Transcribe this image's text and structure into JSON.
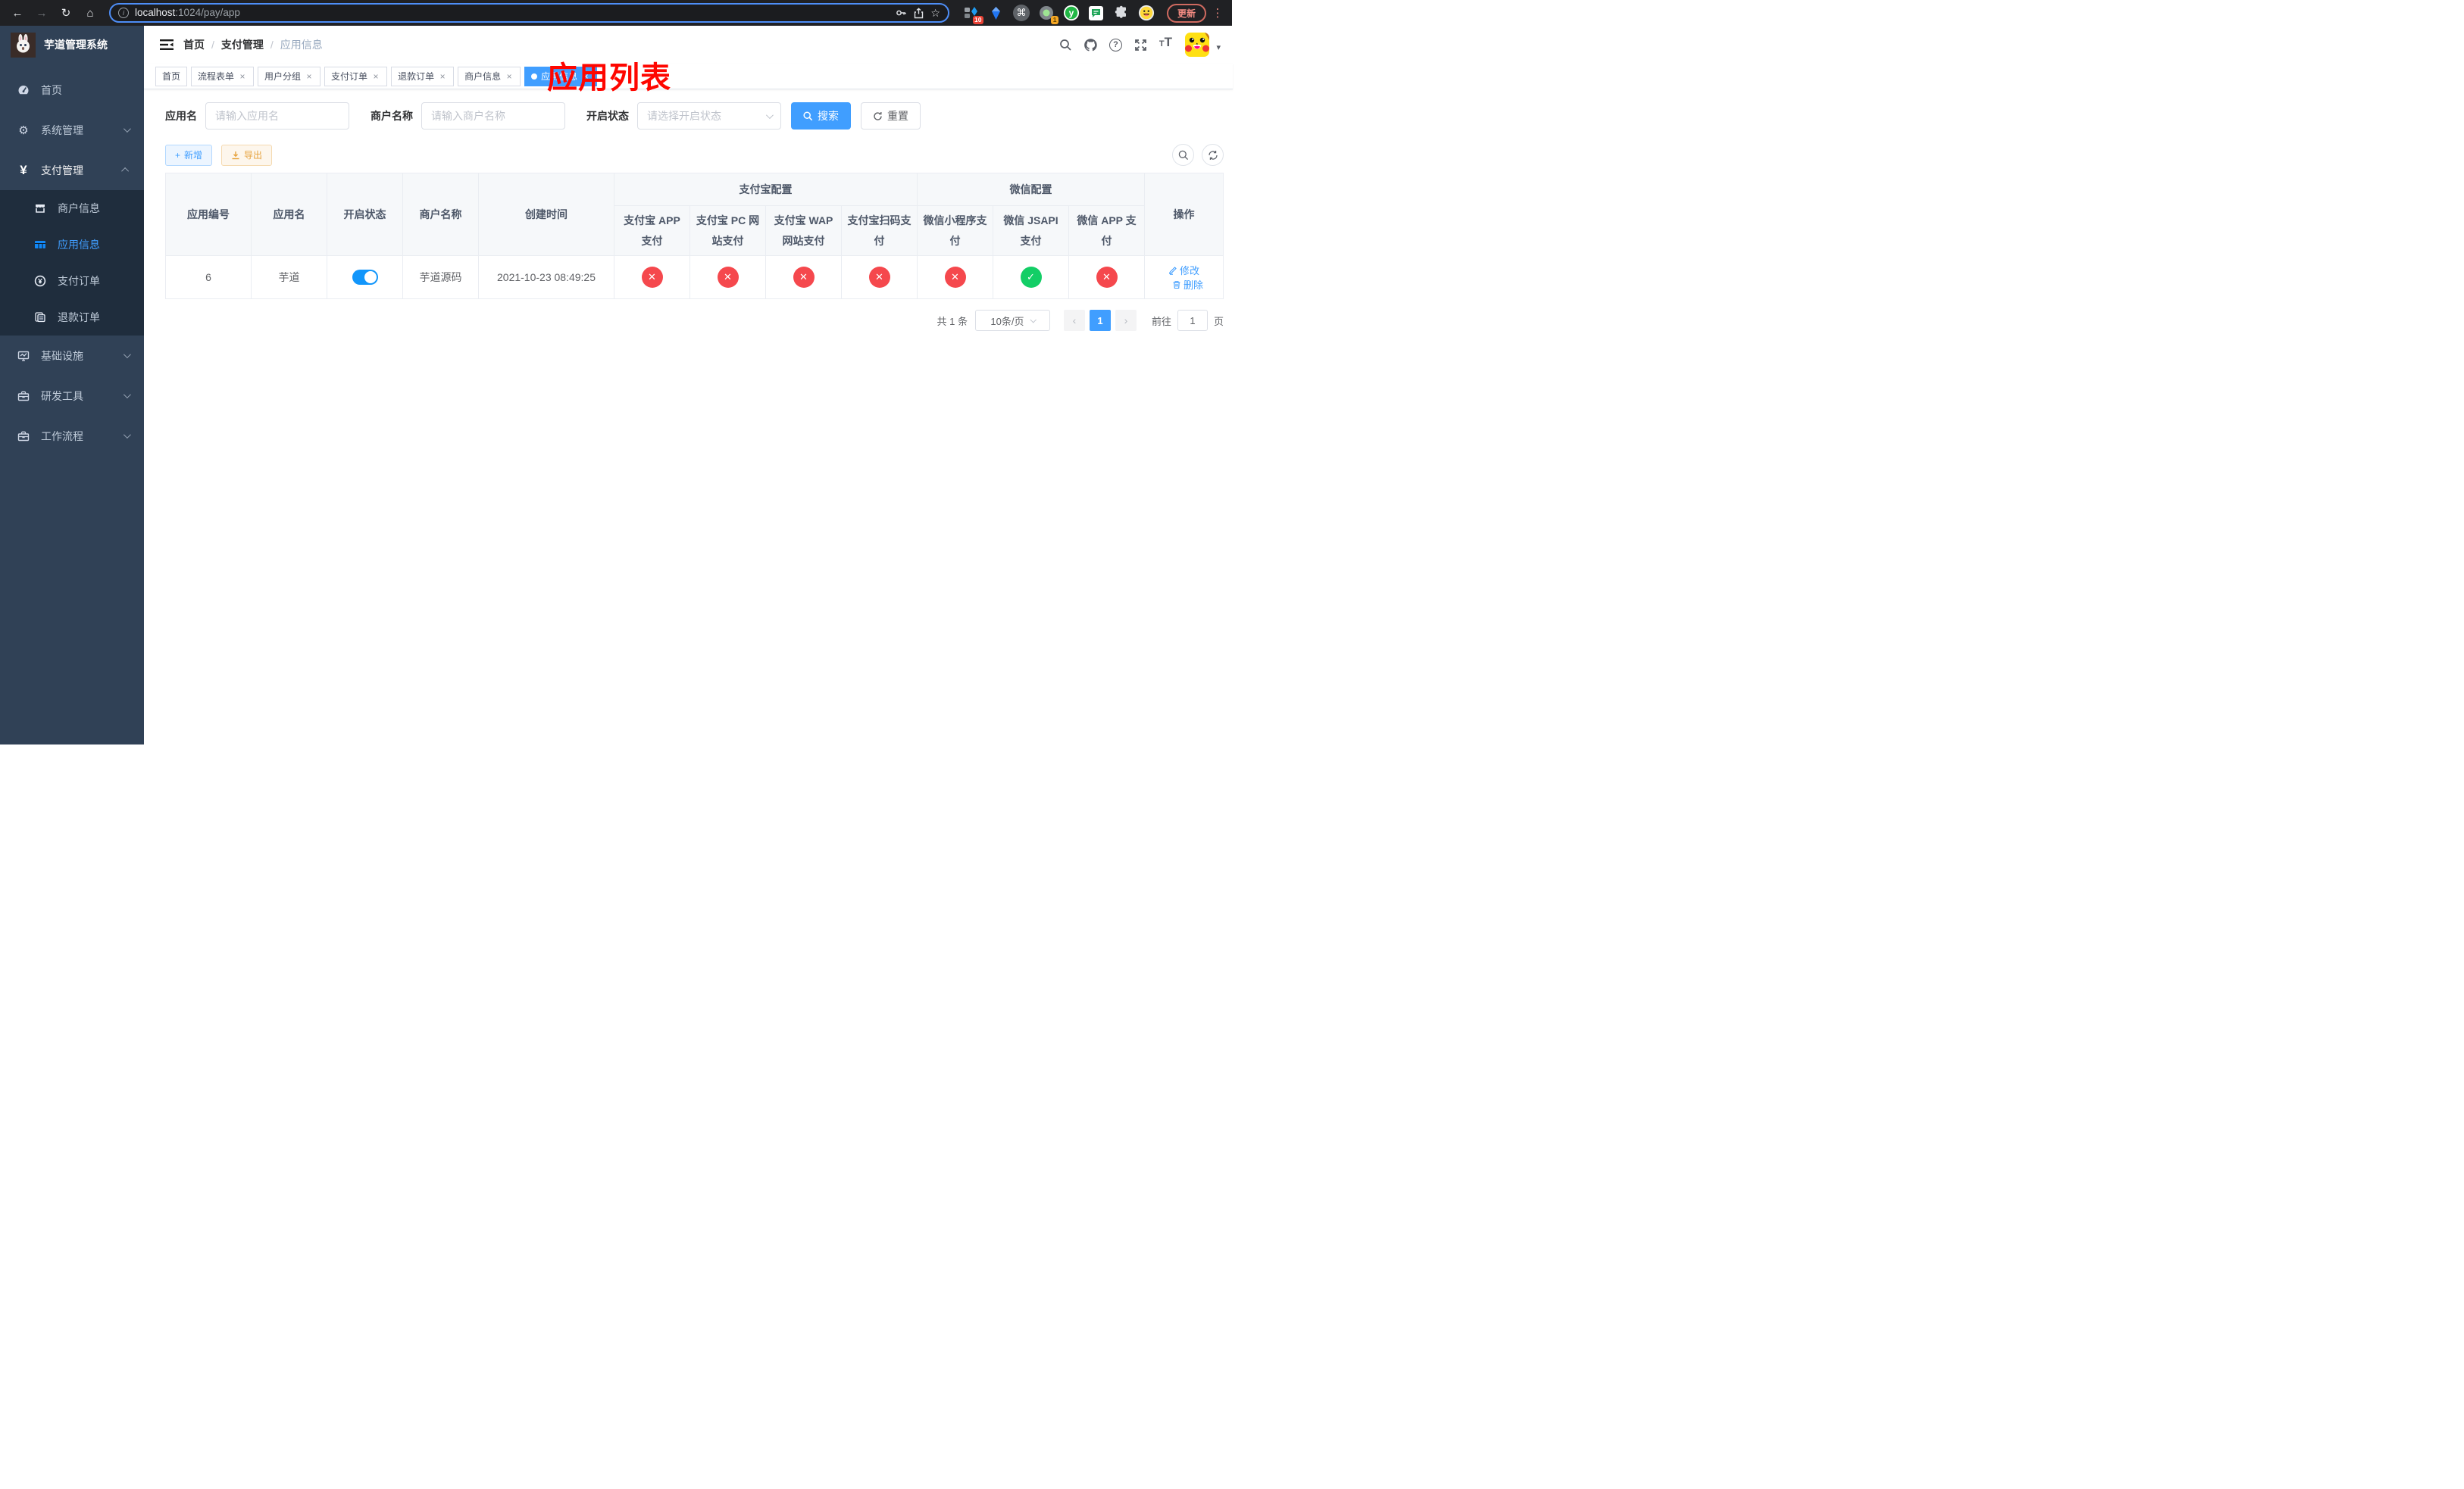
{
  "browser": {
    "url_host": "localhost",
    "url_rest": ":1024/pay/app",
    "update_label": "更新",
    "ext_badge_translate": "10",
    "ext_badge_record": "1",
    "ext_y_letter": "y"
  },
  "app": {
    "title": "芋道管理系统"
  },
  "sidebar": {
    "items": [
      {
        "label": "首页"
      },
      {
        "label": "系统管理"
      },
      {
        "label": "支付管理"
      },
      {
        "label": "基础设施"
      },
      {
        "label": "研发工具"
      },
      {
        "label": "工作流程"
      }
    ],
    "submenu": [
      {
        "label": "商户信息"
      },
      {
        "label": "应用信息"
      },
      {
        "label": "支付订单"
      },
      {
        "label": "退款订单"
      }
    ]
  },
  "breadcrumb": {
    "items": [
      "首页",
      "支付管理",
      "应用信息"
    ],
    "separator": "/"
  },
  "annotation": {
    "text": "应用列表",
    "color": "#fe0600"
  },
  "tabs": [
    {
      "label": "首页"
    },
    {
      "label": "流程表单"
    },
    {
      "label": "用户分组"
    },
    {
      "label": "支付订单"
    },
    {
      "label": "退款订单"
    },
    {
      "label": "商户信息"
    },
    {
      "label": "应用信息"
    }
  ],
  "filters": {
    "app_name_label": "应用名",
    "app_name_placeholder": "请输入应用名",
    "merchant_label": "商户名称",
    "merchant_placeholder": "请输入商户名称",
    "status_label": "开启状态",
    "status_placeholder": "请选择开启状态",
    "search_label": "搜索",
    "reset_label": "重置"
  },
  "toolbar": {
    "add_label": "新增",
    "export_label": "导出"
  },
  "table": {
    "columns": [
      "应用编号",
      "应用名",
      "开启状态",
      "商户名称",
      "创建时间"
    ],
    "groups": [
      {
        "label": "支付宝配置"
      },
      {
        "label": "微信配置"
      }
    ],
    "sub_columns": [
      "支付宝 APP 支付",
      "支付宝 PC 网站支付",
      "支付宝 WAP 网站支付",
      "支付宝扫码支付",
      "微信小程序支付",
      "微信 JSAPI 支付",
      "微信 APP 支付"
    ],
    "action_label": "操作",
    "row": {
      "id": "6",
      "name": "芋道",
      "enabled": true,
      "merchant": "芋道源码",
      "created_at": "2021-10-23 08:49:25",
      "configs": [
        "no",
        "no",
        "no",
        "no",
        "no",
        "yes",
        "no"
      ],
      "edit_label": "修改",
      "delete_label": "删除"
    }
  },
  "pagination": {
    "total": "共 1 条",
    "size": "10条/页",
    "page": "1",
    "goto_label": "前往",
    "goto_value": "1",
    "page_unit": "页"
  },
  "icons": {
    "close": "×",
    "check": "✓",
    "cross": "✕",
    "plus": "+",
    "back": "←",
    "forward": "→",
    "reload": "↻",
    "home": "⌂",
    "star": "☆",
    "cmd": "⌘",
    "question": "?",
    "caret": "▾",
    "dots": "⋮",
    "prev": "‹",
    "next": "›",
    "yen": "¥",
    "gear": "⚙",
    "info": "i",
    "font_small": "T",
    "font_large": "T"
  },
  "colors": {
    "primary": "#409eff",
    "danger": "#f5484d",
    "success": "#13ce66",
    "sidebar": "#304156"
  }
}
